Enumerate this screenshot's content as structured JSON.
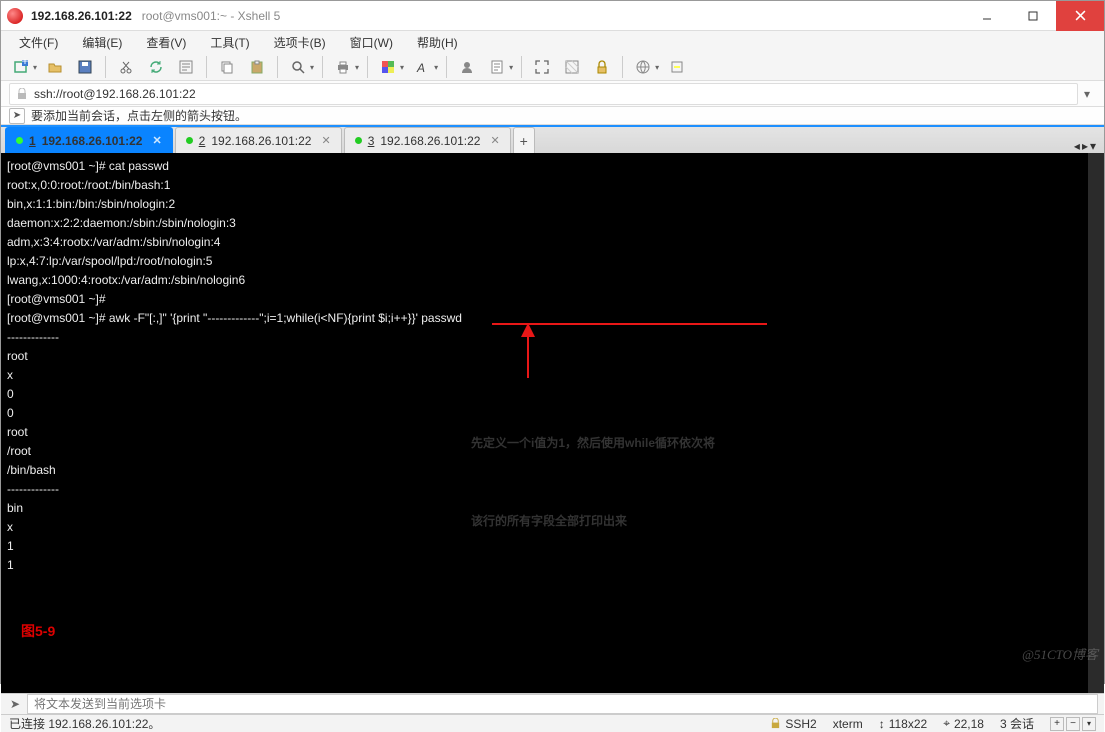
{
  "title": {
    "host": "192.168.26.101:22",
    "sub": "root@vms001:~ - Xshell 5"
  },
  "menus": {
    "file": "文件(F)",
    "edit": "编辑(E)",
    "view": "查看(V)",
    "tools": "工具(T)",
    "tabs": "选项卡(B)",
    "window": "窗口(W)",
    "help": "帮助(H)"
  },
  "address": "ssh://root@192.168.26.101:22",
  "info_hint": "要添加当前会话，点击左侧的箭头按钮。",
  "tabs": [
    {
      "num": "1",
      "label": "192.168.26.101:22",
      "active": true
    },
    {
      "num": "2",
      "label": "192.168.26.101:22",
      "active": false
    },
    {
      "num": "3",
      "label": "192.168.26.101:22",
      "active": false
    }
  ],
  "terminal_lines": [
    "[root@vms001 ~]# cat passwd",
    "root:x,0:0:root:/root:/bin/bash:1",
    "bin,x:1:1:bin:/bin:/sbin/nologin:2",
    "daemon:x:2:2:daemon:/sbin:/sbin/nologin:3",
    "adm,x:3:4:rootx:/var/adm:/sbin/nologin:4",
    "lp:x,4:7:lp:/var/spool/lpd:/root/nologin:5",
    "lwang,x:1000:4:rootx:/var/adm:/sbin/nologin6",
    "[root@vms001 ~]#",
    "[root@vms001 ~]# awk -F\"[:,]\" '{print \"-------------\";i=1;while(i<NF){print $i;i++}}' passwd",
    "-------------",
    "root",
    "x",
    "0",
    "0",
    "root",
    "/root",
    "/bin/bash",
    "-------------",
    "bin",
    "x",
    "1",
    "1"
  ],
  "annotation": {
    "line1": "先定义一个i值为1，然后使用while循环依次将",
    "line2": "该行的所有字段全部打印出来"
  },
  "figure_label": "图5-9",
  "send_placeholder": "将文本发送到当前选项卡",
  "status": {
    "connected": "已连接 192.168.26.101:22。",
    "ssh": "SSH2",
    "term": "xterm",
    "size": "118x22",
    "cursor": "22,18",
    "sessions": "3 会话"
  },
  "watermark": "@51CTO博客",
  "colors": {
    "accent_blue": "#0a84ff",
    "close_red": "#e0413e",
    "annot_red": "#e81717"
  }
}
